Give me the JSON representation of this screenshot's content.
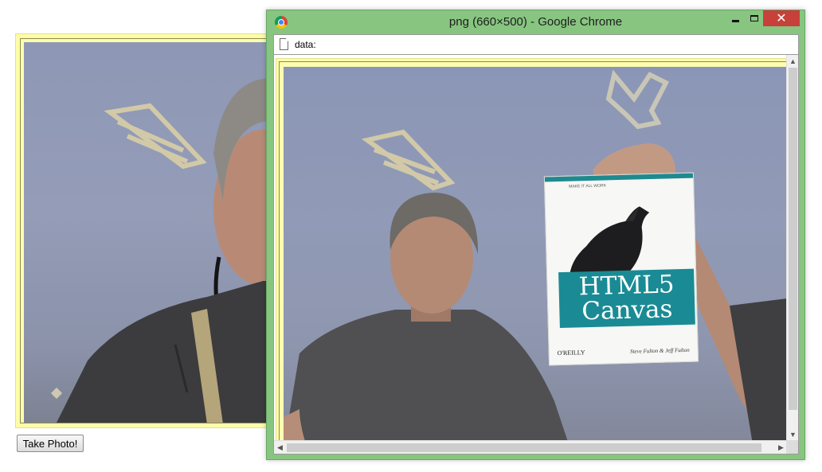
{
  "background_page": {
    "take_photo_label": "Take Photo!"
  },
  "popup_window": {
    "title": "png (660×500) - Google Chrome",
    "controls": {
      "minimize_icon": "minimize-icon",
      "maximize_icon": "maximize-icon",
      "close_glyph": "✕"
    },
    "address": "data:",
    "scroll_glyphs": {
      "up": "▲",
      "down": "▼",
      "left": "◀",
      "right": "▶"
    }
  },
  "book_cover": {
    "tagline": "MAKE IT ALL WORK",
    "title_line1": "HTML5",
    "title_line2": "Canvas",
    "publisher": "O'REILLY",
    "authors": "Steve Fulton & Jeff Fulton"
  },
  "colors": {
    "window_border": "#87c580",
    "close_button": "#c7413a",
    "frame_yellow": "#fdfda8",
    "book_teal": "#1a8b94"
  }
}
